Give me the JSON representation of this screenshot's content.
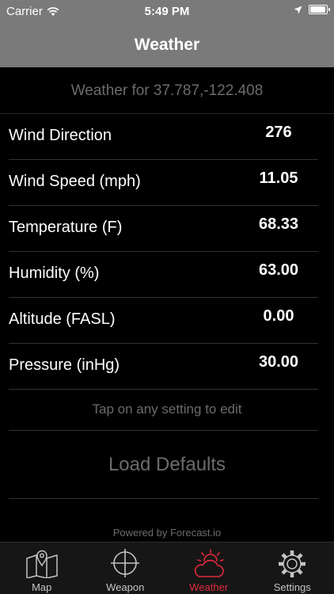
{
  "status_bar": {
    "carrier": "Carrier",
    "time": "5:49 PM",
    "battery_level": 0.95
  },
  "nav": {
    "title": "Weather"
  },
  "subtitle": "Weather for 37.787,-122.408",
  "rows": [
    {
      "label": "Wind Direction",
      "value": "276"
    },
    {
      "label": "Wind Speed (mph)",
      "value": "11.05"
    },
    {
      "label": "Temperature (F)",
      "value": "68.33"
    },
    {
      "label": "Humidity (%)",
      "value": "63.00"
    },
    {
      "label": "Altitude (FASL)",
      "value": "0.00"
    },
    {
      "label": "Pressure (inHg)",
      "value": "30.00"
    }
  ],
  "hint": "Tap on any setting to edit",
  "load_defaults_label": "Load Defaults",
  "powered_by": "Powered by Forecast.io",
  "tabs": [
    {
      "label": "Map",
      "icon": "map-icon",
      "active": false
    },
    {
      "label": "Weapon",
      "icon": "crosshair-icon",
      "active": false
    },
    {
      "label": "Weather",
      "icon": "weather-icon",
      "active": true
    },
    {
      "label": "Settings",
      "icon": "gear-icon",
      "active": false
    }
  ],
  "colors": {
    "active_tab": "#e02b3c",
    "bar": "#7a7a7a",
    "muted_text": "#6b6b6b"
  }
}
